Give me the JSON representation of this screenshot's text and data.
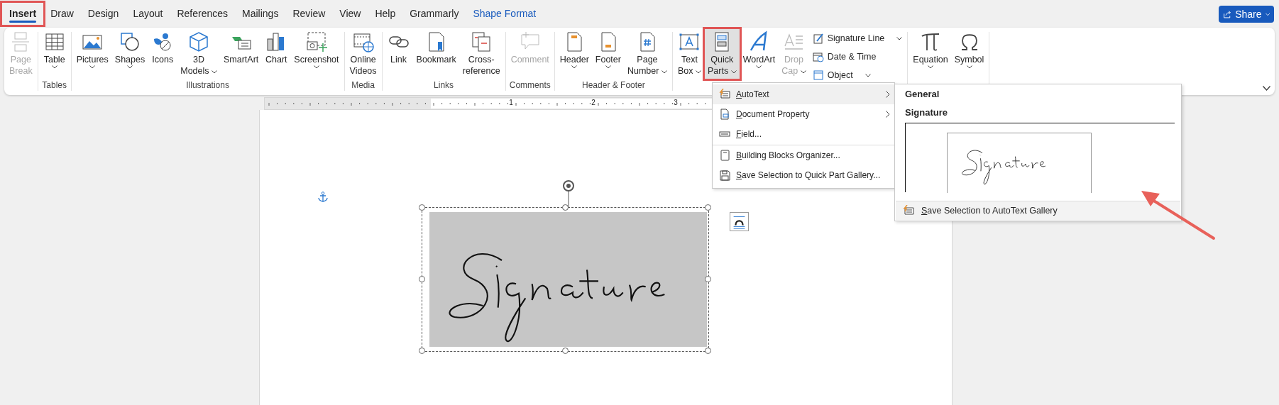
{
  "tabs": [
    {
      "label": "Insert",
      "selected": true,
      "contextual": false,
      "annotated": true
    },
    {
      "label": "Draw",
      "selected": false,
      "contextual": false,
      "annotated": false
    },
    {
      "label": "Design",
      "selected": false,
      "contextual": false,
      "annotated": false
    },
    {
      "label": "Layout",
      "selected": false,
      "contextual": false,
      "annotated": false
    },
    {
      "label": "References",
      "selected": false,
      "contextual": false,
      "annotated": false
    },
    {
      "label": "Mailings",
      "selected": false,
      "contextual": false,
      "annotated": false
    },
    {
      "label": "Review",
      "selected": false,
      "contextual": false,
      "annotated": false
    },
    {
      "label": "View",
      "selected": false,
      "contextual": false,
      "annotated": false
    },
    {
      "label": "Help",
      "selected": false,
      "contextual": false,
      "annotated": false
    },
    {
      "label": "Grammarly",
      "selected": false,
      "contextual": false,
      "annotated": false
    },
    {
      "label": "Shape Format",
      "selected": false,
      "contextual": true,
      "annotated": false
    }
  ],
  "share_button": {
    "label": "Share"
  },
  "ribbon": {
    "groups": [
      {
        "buttons": [
          {
            "label": "Page\nBreak",
            "kind": "large",
            "dropdown": false,
            "disabled": true,
            "pressed": false,
            "annotated": false
          }
        ]
      },
      {
        "label": "Tables",
        "buttons": [
          {
            "label": "Table",
            "kind": "large",
            "dropdown": true,
            "disabled": false,
            "pressed": false,
            "annotated": false
          }
        ]
      },
      {
        "label": "Illustrations",
        "buttons": [
          {
            "label": "Pictures",
            "kind": "large",
            "dropdown": true,
            "disabled": false,
            "pressed": false,
            "annotated": false
          },
          {
            "label": "Shapes",
            "kind": "large",
            "dropdown": true,
            "disabled": false,
            "pressed": false,
            "annotated": false
          },
          {
            "label": "Icons",
            "kind": "large",
            "dropdown": false,
            "disabled": false,
            "pressed": false,
            "annotated": false
          },
          {
            "label": "3D\nModels",
            "kind": "large",
            "dropdown": true,
            "disabled": false,
            "pressed": false,
            "annotated": false
          },
          {
            "label": "SmartArt",
            "kind": "large",
            "dropdown": false,
            "disabled": false,
            "pressed": false,
            "annotated": false
          },
          {
            "label": "Chart",
            "kind": "large",
            "dropdown": false,
            "disabled": false,
            "pressed": false,
            "annotated": false
          },
          {
            "label": "Screenshot",
            "kind": "large",
            "dropdown": true,
            "disabled": false,
            "pressed": false,
            "annotated": false
          }
        ]
      },
      {
        "label": "Media",
        "buttons": [
          {
            "label": "Online\nVideos",
            "kind": "large",
            "dropdown": false,
            "disabled": false,
            "pressed": false,
            "annotated": false
          }
        ]
      },
      {
        "label": "Links",
        "buttons": [
          {
            "label": "Link",
            "kind": "large",
            "dropdown": false,
            "disabled": false,
            "pressed": false,
            "annotated": false
          },
          {
            "label": "Bookmark",
            "kind": "large",
            "dropdown": false,
            "disabled": false,
            "pressed": false,
            "annotated": false
          },
          {
            "label": "Cross-\nreference",
            "kind": "large",
            "dropdown": false,
            "disabled": false,
            "pressed": false,
            "annotated": false
          }
        ]
      },
      {
        "label": "Comments",
        "buttons": [
          {
            "label": "Comment",
            "kind": "large",
            "dropdown": false,
            "disabled": true,
            "pressed": false,
            "annotated": false
          }
        ]
      },
      {
        "label": "Header & Footer",
        "buttons": [
          {
            "label": "Header",
            "kind": "large",
            "dropdown": true,
            "disabled": false,
            "pressed": false,
            "annotated": false
          },
          {
            "label": "Footer",
            "kind": "large",
            "dropdown": true,
            "disabled": false,
            "pressed": false,
            "annotated": false
          },
          {
            "label": "Page\nNumber",
            "kind": "large",
            "dropdown": true,
            "disabled": false,
            "pressed": false,
            "annotated": false
          }
        ]
      },
      {
        "buttons": [
          {
            "label": "Text\nBox",
            "kind": "large",
            "dropdown": true,
            "disabled": false,
            "pressed": false,
            "annotated": false
          },
          {
            "label": "Quick\nParts",
            "kind": "large",
            "dropdown": true,
            "disabled": false,
            "pressed": true,
            "annotated": true
          },
          {
            "label": "WordArt",
            "kind": "large",
            "dropdown": true,
            "disabled": false,
            "pressed": false,
            "annotated": false
          },
          {
            "label": "Drop\nCap",
            "kind": "large",
            "dropdown": true,
            "disabled": true,
            "pressed": false,
            "annotated": false
          },
          {
            "label": "Signature Line",
            "kind": "small",
            "dropdown": true,
            "disabled": false,
            "pressed": false,
            "annotated": false
          },
          {
            "label": "Date & Time",
            "kind": "small",
            "dropdown": false,
            "disabled": false,
            "pressed": false,
            "annotated": false
          },
          {
            "label": "Object",
            "kind": "small",
            "dropdown": true,
            "disabled": false,
            "pressed": false,
            "annotated": false
          }
        ]
      },
      {
        "buttons": [
          {
            "label": "Equation",
            "kind": "large",
            "dropdown": true,
            "disabled": false,
            "pressed": false,
            "annotated": false
          },
          {
            "label": "Symbol",
            "kind": "large",
            "dropdown": true,
            "disabled": false,
            "pressed": false,
            "annotated": false
          }
        ]
      }
    ]
  },
  "ruler": {
    "marks": [
      "1",
      "2",
      "3"
    ]
  },
  "quick_parts_menu": {
    "items": [
      {
        "label": "AutoText",
        "submenu": true,
        "selected": true,
        "separator_before": false
      },
      {
        "label": "Document Property",
        "submenu": true,
        "selected": false,
        "separator_before": false
      },
      {
        "label": "Field...",
        "submenu": false,
        "selected": false,
        "separator_before": false
      },
      {
        "label": "Building Blocks Organizer...",
        "submenu": false,
        "selected": false,
        "separator_before": true
      },
      {
        "label": "Save Selection to Quick Part Gallery...",
        "submenu": false,
        "selected": false,
        "separator_before": false
      }
    ]
  },
  "autotext_gallery": {
    "heading": "General",
    "category": "Signature",
    "footer": "Save Selection to AutoText Gallery"
  }
}
